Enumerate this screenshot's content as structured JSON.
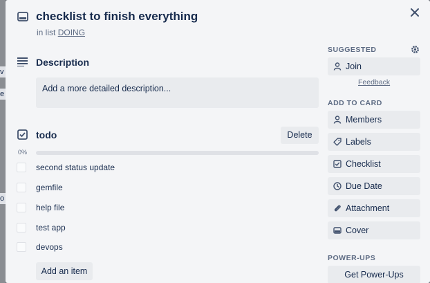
{
  "card": {
    "title": "checklist to finish everything",
    "in_list_prefix": "in list",
    "list_name": "DOING"
  },
  "description": {
    "heading": "Description",
    "placeholder": "Add a more detailed description..."
  },
  "checklist": {
    "title": "todo",
    "delete_label": "Delete",
    "progress_label": "0%",
    "progress": 0,
    "items": [
      {
        "text": "second status update",
        "checked": false
      },
      {
        "text": "gemfile",
        "checked": false
      },
      {
        "text": "help file",
        "checked": false
      },
      {
        "text": "test app",
        "checked": false
      },
      {
        "text": "devops",
        "checked": false
      }
    ],
    "add_item_label": "Add an item"
  },
  "sidebar": {
    "suggested_heading": "SUGGESTED",
    "join_label": "Join",
    "feedback_label": "Feedback",
    "add_to_card_heading": "ADD TO CARD",
    "add_to_card": [
      {
        "label": "Members",
        "icon": "person-icon"
      },
      {
        "label": "Labels",
        "icon": "tag-icon"
      },
      {
        "label": "Checklist",
        "icon": "checklist-icon"
      },
      {
        "label": "Due Date",
        "icon": "clock-icon"
      },
      {
        "label": "Attachment",
        "icon": "paperclip-icon"
      },
      {
        "label": "Cover",
        "icon": "cover-icon"
      }
    ],
    "powerups_heading": "POWER-UPS",
    "get_powerups_label": "Get Power-Ups"
  },
  "background_fragments": [
    "v",
    "e",
    "o"
  ],
  "colors": {
    "modal_bg": "#f4f5f7",
    "button_bg": "#e9ebee",
    "text": "#172b4d",
    "muted": "#5e6c84"
  }
}
